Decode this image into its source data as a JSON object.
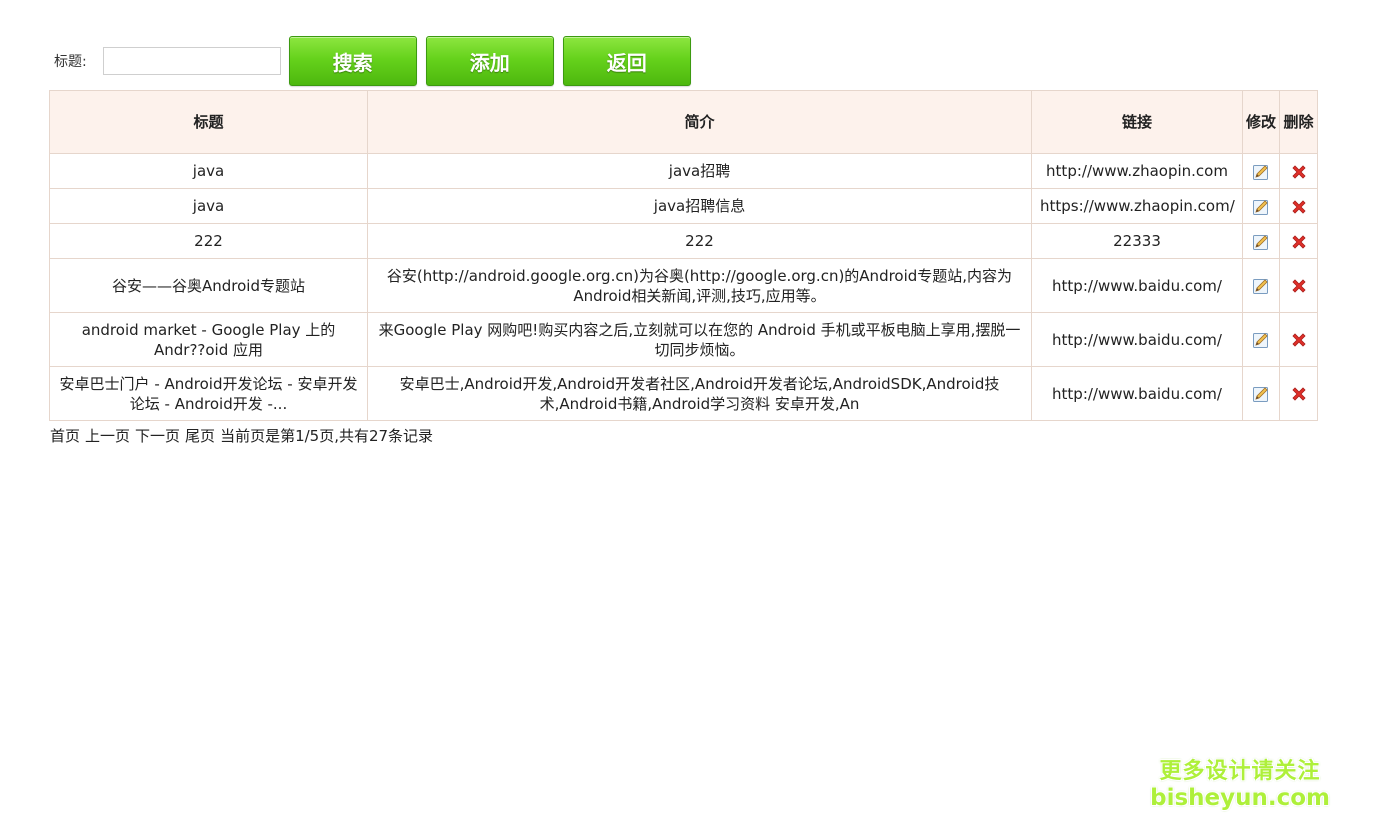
{
  "search": {
    "label": "标题:",
    "input_value": "",
    "input_placeholder": ""
  },
  "toolbar": {
    "search_label": "搜索",
    "add_label": "添加",
    "back_label": "返回"
  },
  "table": {
    "headers": {
      "title": "标题",
      "summary": "简介",
      "link": "链接",
      "edit": "修改",
      "delete": "删除"
    },
    "rows": [
      {
        "title": "java",
        "summary": "java招聘",
        "link": "http://www.zhaopin.com"
      },
      {
        "title": "java",
        "summary": "java招聘信息",
        "link": "https://www.zhaopin.com/"
      },
      {
        "title": "222",
        "summary": "222",
        "link": "22333"
      },
      {
        "title": "谷安——谷奥Android专题站",
        "summary": "谷安(http://android.google.org.cn)为谷奥(http://google.org.cn)的Android专题站,内容为Android相关新闻,评测,技巧,应用等。",
        "link": "http://www.baidu.com/"
      },
      {
        "title": "android market - Google Play 上的 Andr??oid 应用",
        "summary": "来Google Play 网购吧!购买内容之后,立刻就可以在您的 Android 手机或平板电脑上享用,摆脱一切同步烦恼。",
        "link": "http://www.baidu.com/"
      },
      {
        "title": "安卓巴士门户 - Android开发论坛 - 安卓开发论坛 - Android开发 -...",
        "summary": "安卓巴士,Android开发,Android开发者社区,Android开发者论坛,AndroidSDK,Android技术,Android书籍,Android学习资料 安卓开发,An",
        "link": "http://www.baidu.com/"
      }
    ]
  },
  "pagination": {
    "first": "首页",
    "prev": "上一页",
    "next": "下一页",
    "last": "尾页",
    "status": "当前页是第1/5页,共有27条记录"
  },
  "watermark": {
    "line1": "更多设计请关注",
    "line2": "bisheyun.com"
  },
  "icons": {
    "edit": "edit-pencil-icon",
    "delete": "red-x-delete-icon"
  },
  "colors": {
    "button_green": "#5cc618",
    "header_bg": "#fdf2ec",
    "border": "#e6d6cc",
    "delete_red": "#e0302a",
    "watermark_green": "#aef03a"
  }
}
